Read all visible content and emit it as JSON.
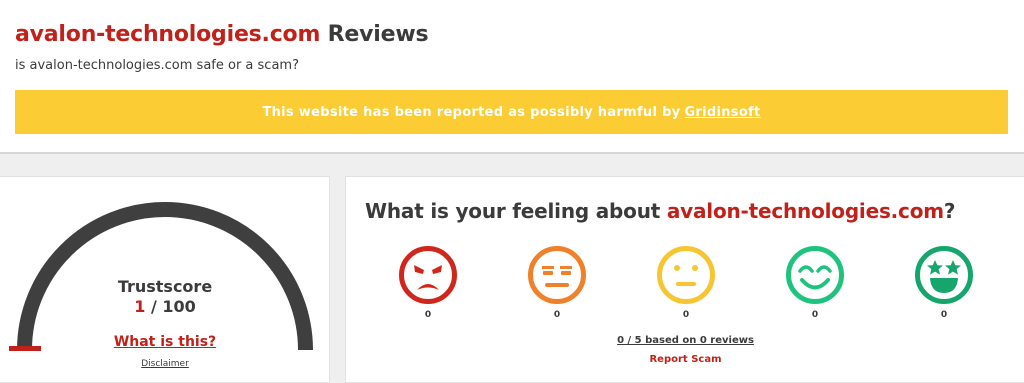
{
  "header": {
    "domain": "avalon-technologies.com",
    "title_suffix": " Reviews",
    "subtitle": "is avalon-technologies.com safe or a scam?"
  },
  "banner": {
    "text": "This website has been reported as possibly harmful by",
    "link_label": "Gridinsoft",
    "bg_color": "#fbcc34"
  },
  "trust": {
    "label": "Trustscore",
    "score": "1",
    "max": " / 100",
    "score_fraction": 0.01,
    "what_link": "What is this?",
    "disclaimer": "Disclaimer"
  },
  "feeling": {
    "title_prefix": "What is your feeling about ",
    "domain": "avalon-technologies.com",
    "title_suffix": "?",
    "reactions": [
      {
        "icon": "angry-face-icon",
        "count": "0",
        "color": "#d0271d"
      },
      {
        "icon": "unamused-face-icon",
        "count": "0",
        "color": "#f0812b"
      },
      {
        "icon": "neutral-face-icon",
        "count": "0",
        "color": "#f6c531"
      },
      {
        "icon": "smiling-face-icon",
        "count": "0",
        "color": "#1fc37e"
      },
      {
        "icon": "star-struck-face-icon",
        "count": "0",
        "color": "#16a56c"
      }
    ],
    "based_on": "0 / 5 based on 0 reviews",
    "report_label": "Report Scam"
  },
  "colors": {
    "accent": "#c0211a",
    "gauge_track": "#3f3f3f",
    "gauge_value": "#c0211a"
  }
}
